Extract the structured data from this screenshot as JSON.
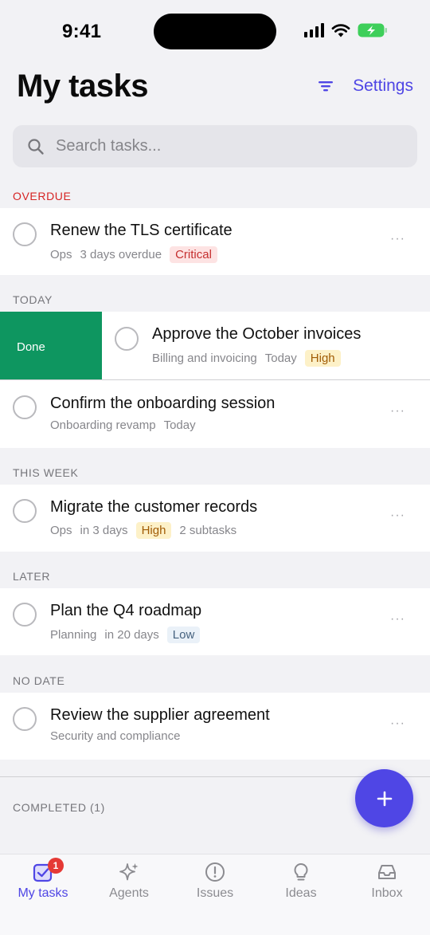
{
  "status_bar": {
    "time": "9:41"
  },
  "header": {
    "title": "My tasks",
    "settings_label": "Settings",
    "filter_icon": "filter-icon"
  },
  "search": {
    "placeholder": "Search tasks..."
  },
  "sections": {
    "overdue": {
      "label": "OVERDUE"
    },
    "today": {
      "label": "TODAY"
    },
    "this_week": {
      "label": "THIS WEEK"
    },
    "later": {
      "label": "LATER"
    },
    "no_date": {
      "label": "NO DATE"
    },
    "completed": {
      "label": "COMPLETED (1)"
    }
  },
  "tasks": {
    "renew_tls": {
      "title": "Renew the TLS certificate",
      "project": "Ops",
      "due": "3 days overdue",
      "priority": "Critical",
      "more": "···"
    },
    "approve_invoices": {
      "title": "Approve the October invoices",
      "project": "Billing and invoicing",
      "due": "Today",
      "priority": "High",
      "swipe_action": "Done"
    },
    "onboarding": {
      "title": "Confirm the onboarding session",
      "project": "Onboarding revamp",
      "due": "Today",
      "more": "···"
    },
    "migrate": {
      "title": "Migrate the customer records",
      "project": "Ops",
      "due": "in 3 days",
      "priority": "High",
      "subtasks": "2 subtasks",
      "more": "···"
    },
    "roadmap": {
      "title": "Plan the Q4 roadmap",
      "project": "Planning",
      "due": "in 20 days",
      "priority": "Low",
      "more": "···"
    },
    "supplier": {
      "title": "Review the supplier agreement",
      "project": "Security and compliance",
      "more": "···"
    }
  },
  "colors": {
    "accent": "#4f46e5",
    "done_green": "#0e9660",
    "critical": "#c53030",
    "overdue": "#d62424",
    "badge_red": "#e53935"
  },
  "tab_bar": {
    "tabs": [
      {
        "label": "My tasks",
        "icon": "check-square-icon",
        "active": true,
        "badge": "1"
      },
      {
        "label": "Agents",
        "icon": "sparkle-icon"
      },
      {
        "label": "Issues",
        "icon": "alert-circle-icon"
      },
      {
        "label": "Ideas",
        "icon": "lightbulb-icon"
      },
      {
        "label": "Inbox",
        "icon": "inbox-icon"
      }
    ]
  }
}
